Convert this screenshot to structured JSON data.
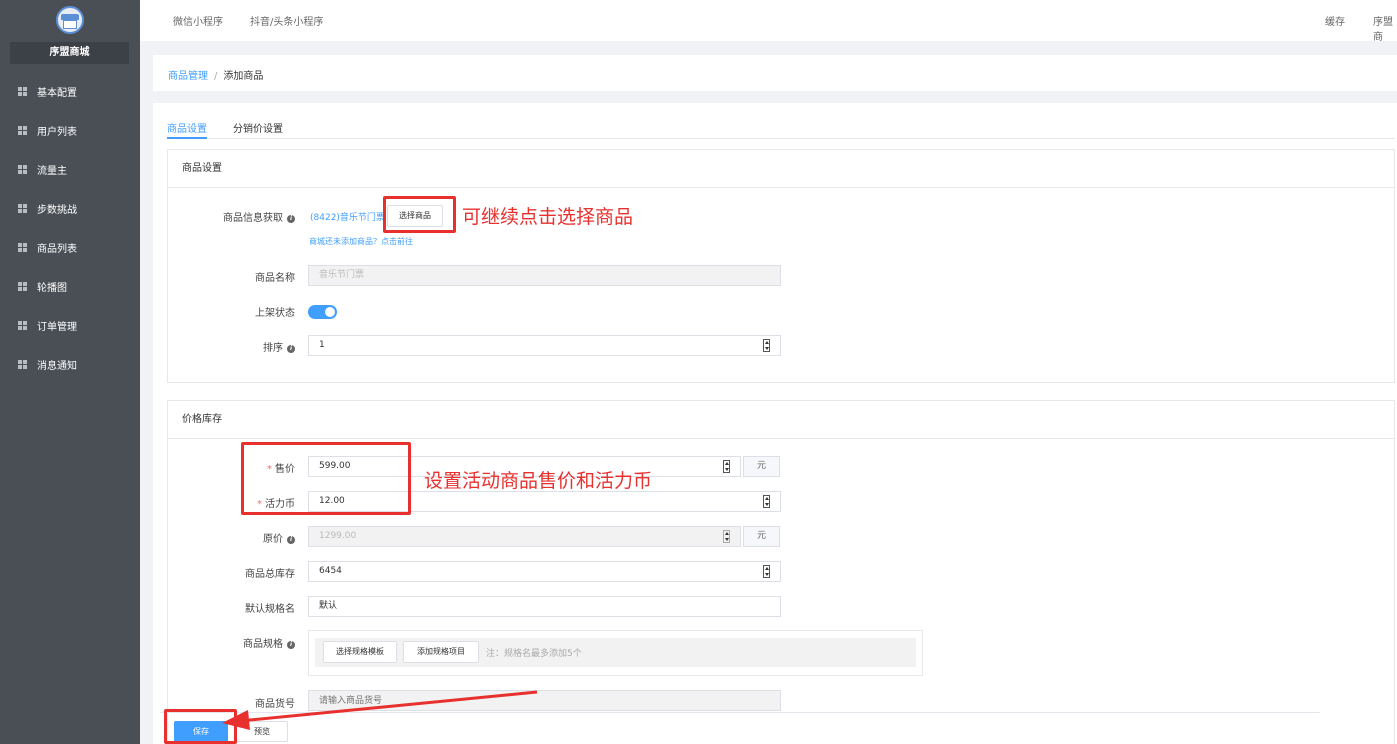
{
  "brand": "序盟商城",
  "sidebar": {
    "items": [
      {
        "label": "基本配置"
      },
      {
        "label": "用户列表"
      },
      {
        "label": "流量主"
      },
      {
        "label": "步数挑战"
      },
      {
        "label": "商品列表"
      },
      {
        "label": "轮播图"
      },
      {
        "label": "订单管理"
      },
      {
        "label": "消息通知"
      }
    ]
  },
  "topbar": {
    "tab1": "微信小程序",
    "tab2": "抖音/头条小程序",
    "cache": "缓存",
    "user": "序盟商"
  },
  "breadcrumb": {
    "parent": "商品管理",
    "separator": "/",
    "current": "添加商品"
  },
  "tabs": {
    "product_settings": "商品设置",
    "distribution_price": "分销价设置"
  },
  "product_card": {
    "title": "商品设置",
    "info_label": "商品信息获取",
    "info_value": "(8422)音乐节门票",
    "select_button": "选择商品",
    "hint_link": "商城还未添加商品？点击前往",
    "name_label": "商品名称",
    "name_value": "音乐节门票",
    "status_label": "上架状态",
    "status_on": true,
    "sort_label": "排序",
    "sort_value": "1"
  },
  "price_card": {
    "title": "价格库存",
    "price_label": "售价",
    "price_value": "599.00",
    "unit": "元",
    "coin_label": "活力币",
    "coin_value": "12.00",
    "original_label": "原价",
    "original_value": "1299.00",
    "stock_label": "商品总库存",
    "stock_value": "6454",
    "spec_name_label": "默认规格名",
    "spec_name_value": "默认",
    "spec_label": "商品规格",
    "spec_template_button": "选择规格模板",
    "spec_add_button": "添加规格项目",
    "spec_hint": "注：规格名最多添加5个",
    "sku_label": "商品货号",
    "sku_placeholder": "请输入商品货号"
  },
  "footer": {
    "save": "保存",
    "preview": "预览"
  },
  "annotations": {
    "select_note": "可继续点击选择商品",
    "price_note": "设置活动商品售价和活力币"
  },
  "colors": {
    "sidebar": "#4a4f56",
    "accent": "#409eff",
    "annotation": "#e8312f"
  }
}
